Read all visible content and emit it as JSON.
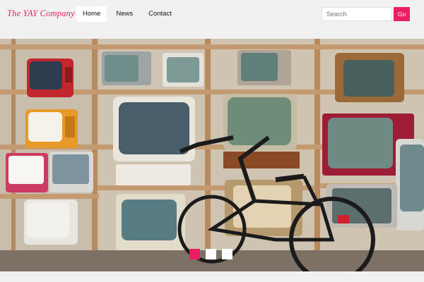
{
  "brand": {
    "name": "The YAY Company"
  },
  "nav": {
    "items": [
      {
        "label": "Home",
        "active": true
      },
      {
        "label": "News",
        "active": false
      },
      {
        "label": "Contact",
        "active": false
      }
    ]
  },
  "search": {
    "placeholder": "Search",
    "value": "",
    "button_label": "Go"
  },
  "hero": {
    "image": "Shelves of vintage televisions with a bicycle in front",
    "slides": [
      {
        "active": true
      },
      {
        "active": false
      },
      {
        "active": false
      }
    ]
  },
  "colors": {
    "accent": "#e91e63",
    "topbar": "#f1f1f1"
  }
}
